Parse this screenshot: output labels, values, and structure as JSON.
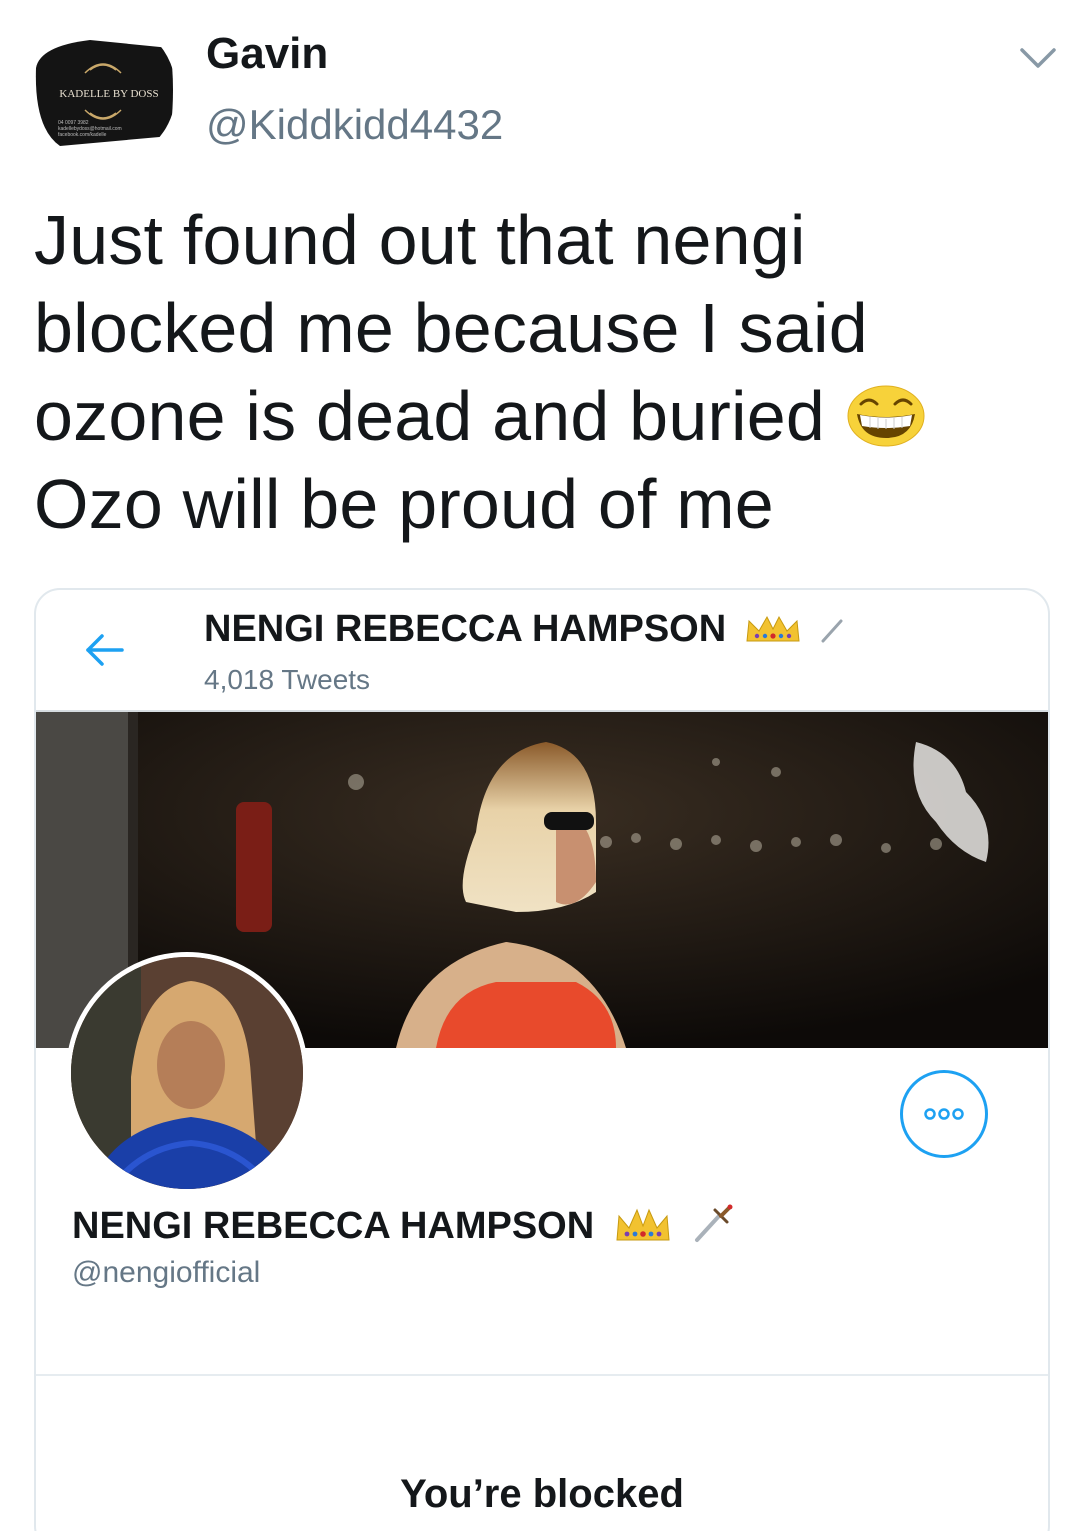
{
  "tweet": {
    "author": {
      "display_name": "Gavin",
      "handle": "@Kiddkidd4432",
      "avatar_text": "KADELLE BY DOSS"
    },
    "text_parts": {
      "before_emoji": "Just found out that nengi blocked me because I said ozone is dead and buried ",
      "emoji": "grinning-squinting-face",
      "after_emoji": " Ozo will be proud of me"
    }
  },
  "embedded_screenshot": {
    "header": {
      "title": "NENGI REBECCA HAMPSON",
      "tweet_count": "4,018 Tweets"
    },
    "profile": {
      "name": "NENGI REBECCA HAMPSON",
      "handle": "@nengiofficial"
    },
    "blocked_message": "You’re blocked",
    "badges": [
      "crown-icon",
      "dagger-icon"
    ]
  },
  "colors": {
    "accent": "#1da1f2",
    "text": "#14171a",
    "secondary_text": "#657786",
    "border": "#e1e8ed"
  }
}
